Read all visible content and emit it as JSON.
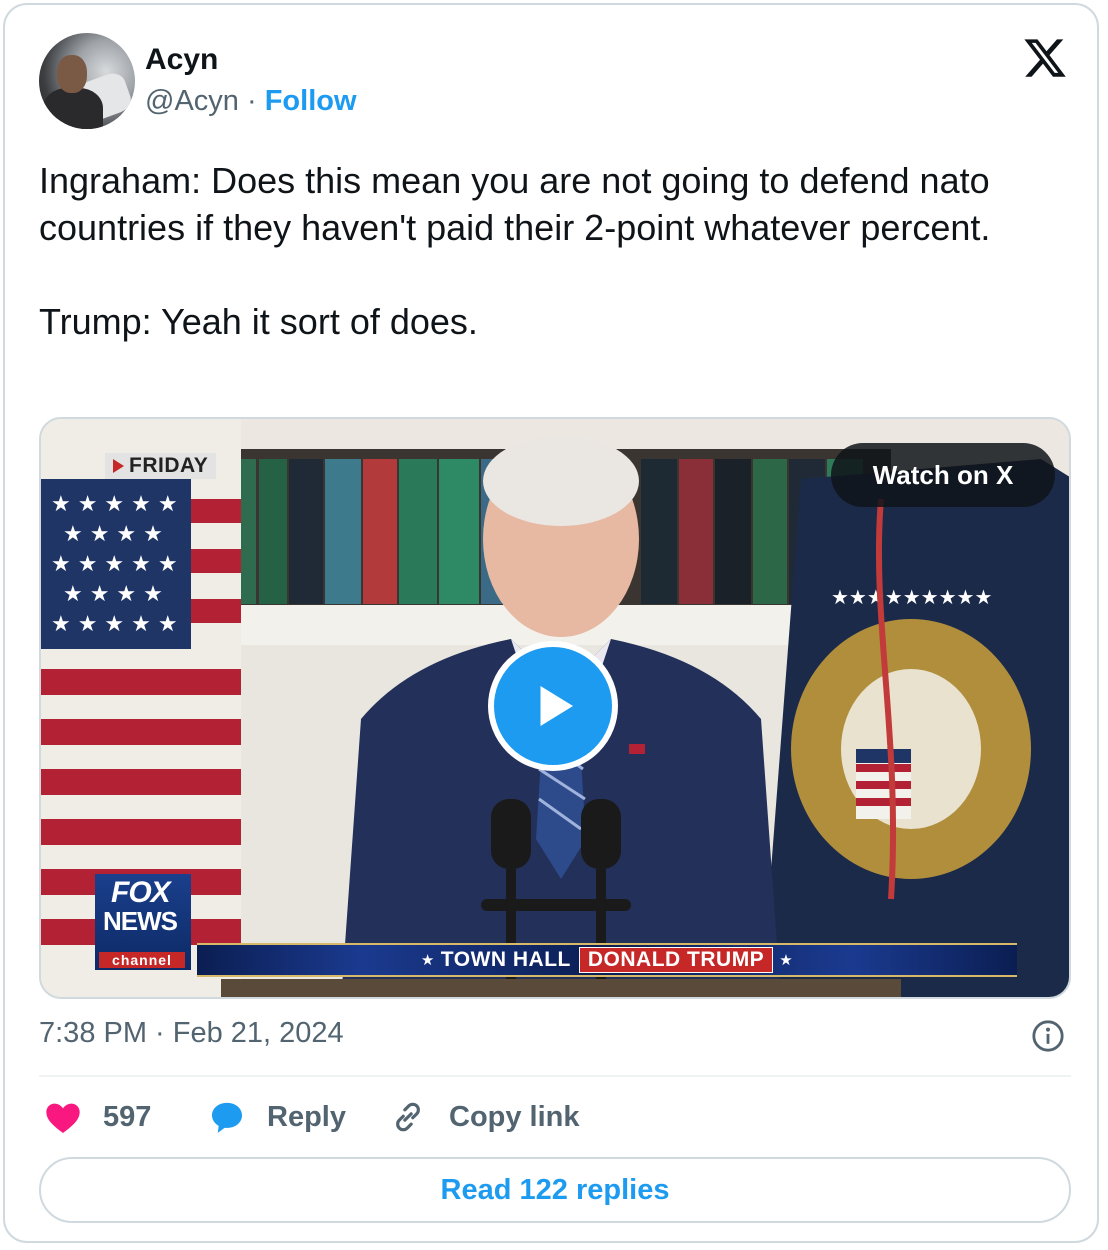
{
  "author": {
    "name": "Acyn",
    "handle": "@Acyn",
    "separator": "·",
    "follow_label": "Follow"
  },
  "tweet": {
    "text": "Ingraham: Does this mean you are not going to defend nato countries if they haven't paid their 2-point whatever percent.\n\nTrump: Yeah it sort of does."
  },
  "media": {
    "tag": "FRIDAY",
    "watch_label": "Watch on X",
    "fox_line1": "FOX",
    "fox_line2": "NEWS",
    "fox_line3": "channel",
    "chyron_left": "TOWN HALL",
    "chyron_right": "DONALD TRUMP"
  },
  "timestamp": "7:38 PM · Feb 21, 2024",
  "actions": {
    "likes": "597",
    "reply_label": "Reply",
    "copy_label": "Copy link"
  },
  "read_replies_label": "Read 122 replies",
  "icons": {
    "like": "heart-icon",
    "reply": "speech-bubble-icon",
    "copy": "link-icon",
    "info": "info-icon",
    "brand": "x-logo-icon",
    "play": "play-icon"
  },
  "colors": {
    "accent": "#1d9bf0",
    "like": "#f91880",
    "muted": "#536471",
    "border": "#cfd9de"
  }
}
